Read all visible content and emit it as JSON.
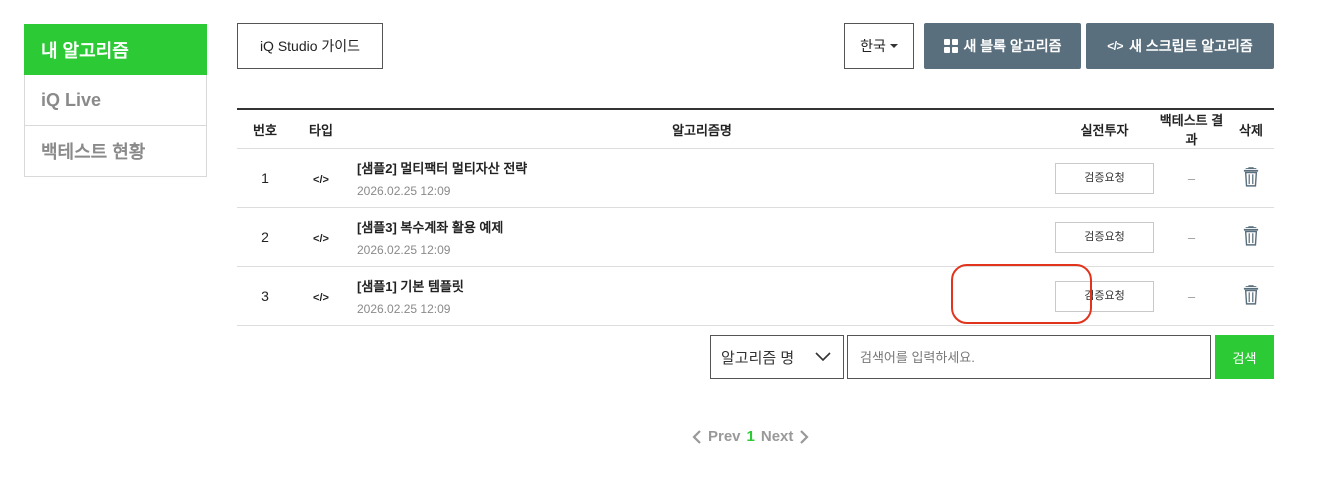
{
  "sidebar": {
    "items": [
      {
        "label": "내 알고리즘",
        "active": true
      },
      {
        "label": "iQ Live",
        "active": false
      },
      {
        "label": "백테스트 현황",
        "active": false
      }
    ]
  },
  "toolbar": {
    "guide_label": "iQ Studio 가이드",
    "language": "한국",
    "new_block_label": "새 블록 알고리즘",
    "new_script_label": "새 스크립트 알고리즘",
    "script_icon_glyph": "</>"
  },
  "table": {
    "headers": {
      "no": "번호",
      "type": "타입",
      "name": "알고리즘명",
      "live": "실전투자",
      "backtest": "백테스트 결과",
      "delete": "삭제"
    },
    "rows": [
      {
        "no": "1",
        "type": "</>",
        "title": "[샘플2] 멀티팩터 멀티자산 전략",
        "date": "2026.02.25 12:09",
        "live_button": "검증요청",
        "backtest": "–"
      },
      {
        "no": "2",
        "type": "</>",
        "title": "[샘플3] 복수계좌 활용 예제",
        "date": "2026.02.25 12:09",
        "live_button": "검증요청",
        "backtest": "–"
      },
      {
        "no": "3",
        "type": "</>",
        "title": "[샘플1] 기본 템플릿",
        "date": "2026.02.25 12:09",
        "live_button": "검증요청",
        "backtest": "–"
      }
    ]
  },
  "search": {
    "field_select": "알고리즘 명",
    "placeholder": "검색어를 입력하세요.",
    "button_label": "검색"
  },
  "pagination": {
    "prev": "Prev",
    "current": "1",
    "next": "Next"
  },
  "colors": {
    "accent_green": "#2ccb35",
    "button_slate": "#5a6f7d",
    "highlight_red": "#e2341d"
  }
}
